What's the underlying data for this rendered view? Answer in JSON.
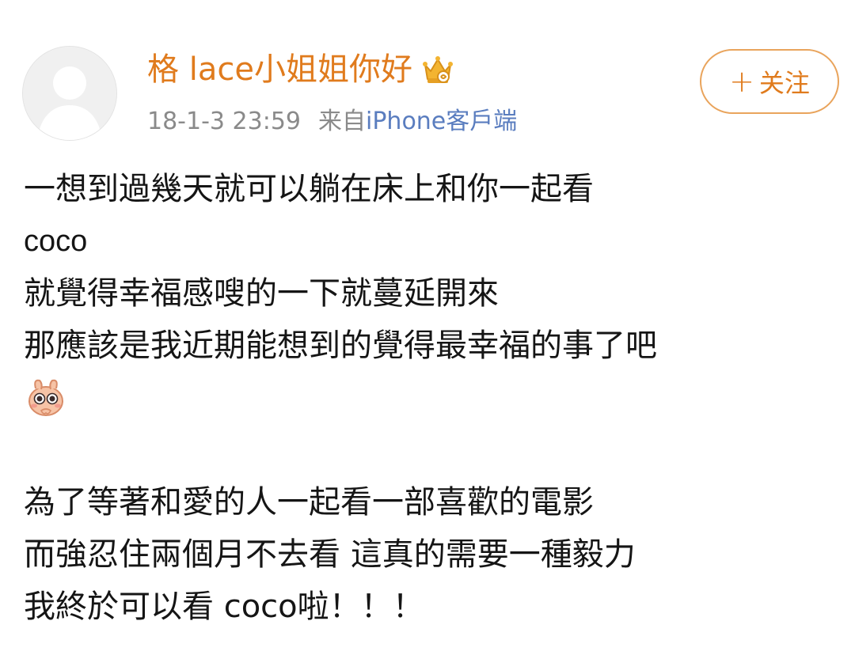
{
  "post": {
    "user": {
      "name": "格 lace小姐姐你好",
      "badge_icon": "crown-badge-icon",
      "avatar_icon": "default-avatar-icon"
    },
    "timestamp": "18-1-3 23:59",
    "source_prefix": "来自",
    "source_app": "iPhone客戶端",
    "follow_button": {
      "icon": "plus-icon",
      "icon_glyph": "+",
      "label": "关注"
    },
    "content_lines": [
      "一想到過幾天就可以躺在床上和你一起看",
      "coco",
      "就覺得幸福感嗖的一下就蔓延開來",
      "那應該是我近期能想到的覺得最幸福的事了吧",
      "為了等著和愛的人一起看一部喜歡的電影",
      "而強忍住兩個月不去看 這真的需要一種毅力",
      "我終於可以看 coco啦！！！"
    ],
    "emoji_icon": "shy-bunny-emoji-icon"
  },
  "colors": {
    "username": "#e07b1d",
    "follow_border": "#e9a45c",
    "meta_gray": "#8a8a8a",
    "source_link": "#5a7dbf",
    "text": "#151515"
  }
}
